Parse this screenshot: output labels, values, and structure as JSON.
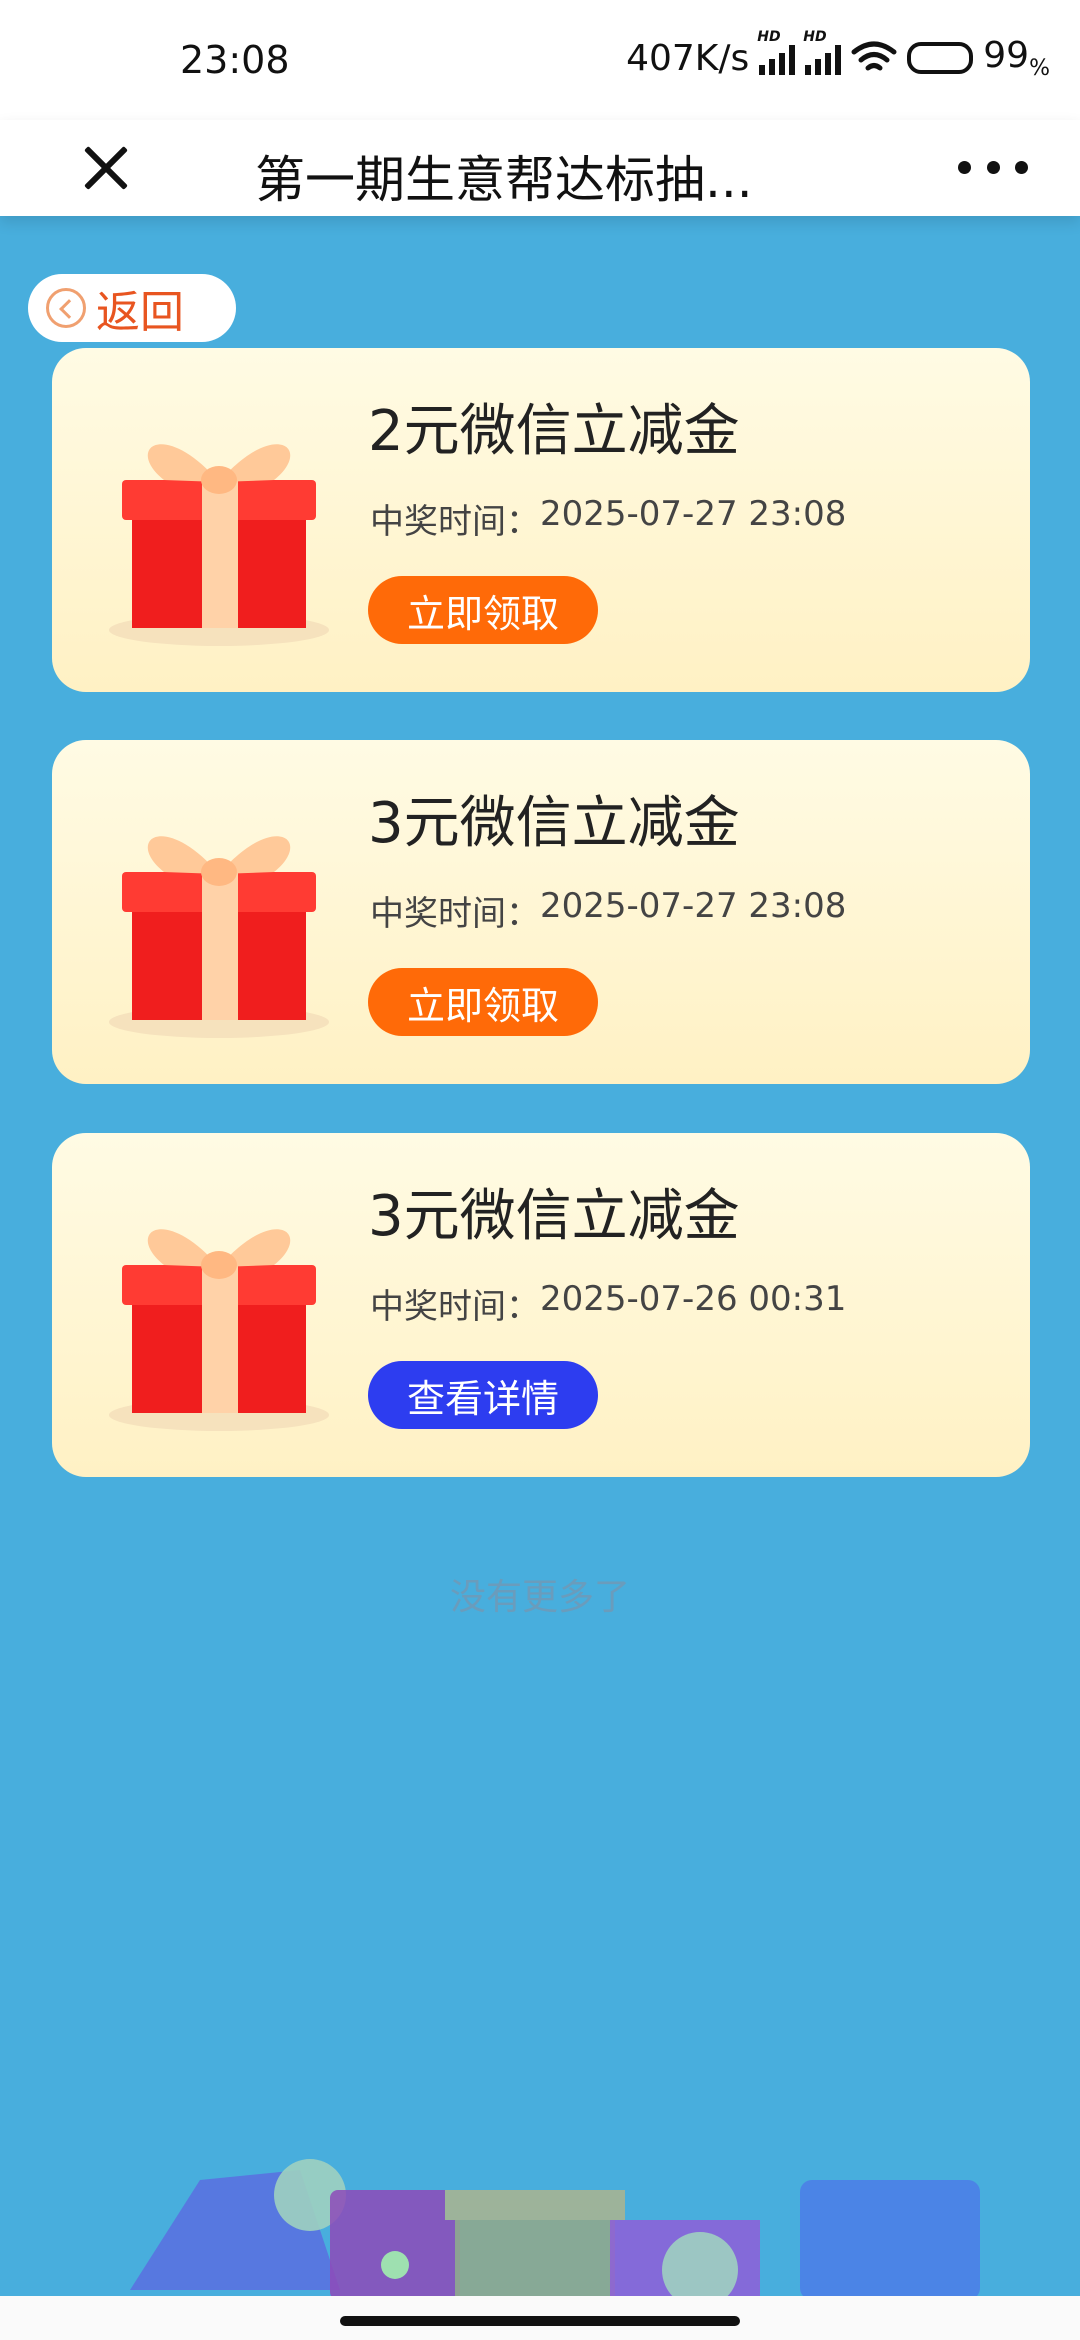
{
  "status_bar": {
    "time": "23:08",
    "speed": "407K/s",
    "signal_label": "HD",
    "battery_percent": "99",
    "battery_unit": "%"
  },
  "nav": {
    "title": "第一期生意帮达标抽..."
  },
  "back_label": "返回",
  "prizes": [
    {
      "title": "2元微信立减金",
      "time_label": "中奖时间：",
      "time_value": "2025-07-27 23:08",
      "button_label": "立即领取",
      "button_color": "#ff6a08"
    },
    {
      "title": "3元微信立减金",
      "time_label": "中奖时间：",
      "time_value": "2025-07-27 23:08",
      "button_label": "立即领取",
      "button_color": "#ff6a08"
    },
    {
      "title": "3元微信立减金",
      "time_label": "中奖时间：",
      "time_value": "2025-07-26 00:31",
      "button_label": "查看详情",
      "button_color": "#2d3df0"
    }
  ],
  "end_text": "没有更多了",
  "colors": {
    "page_background": "#48aedd",
    "accent_orange": "#ff6a08",
    "accent_blue": "#2d3df0",
    "back_text": "#e85520"
  },
  "icons": [
    "close-icon",
    "more-icon",
    "back-chevron-icon",
    "gift-icon",
    "wifi-icon",
    "battery-icon",
    "signal-icon"
  ]
}
